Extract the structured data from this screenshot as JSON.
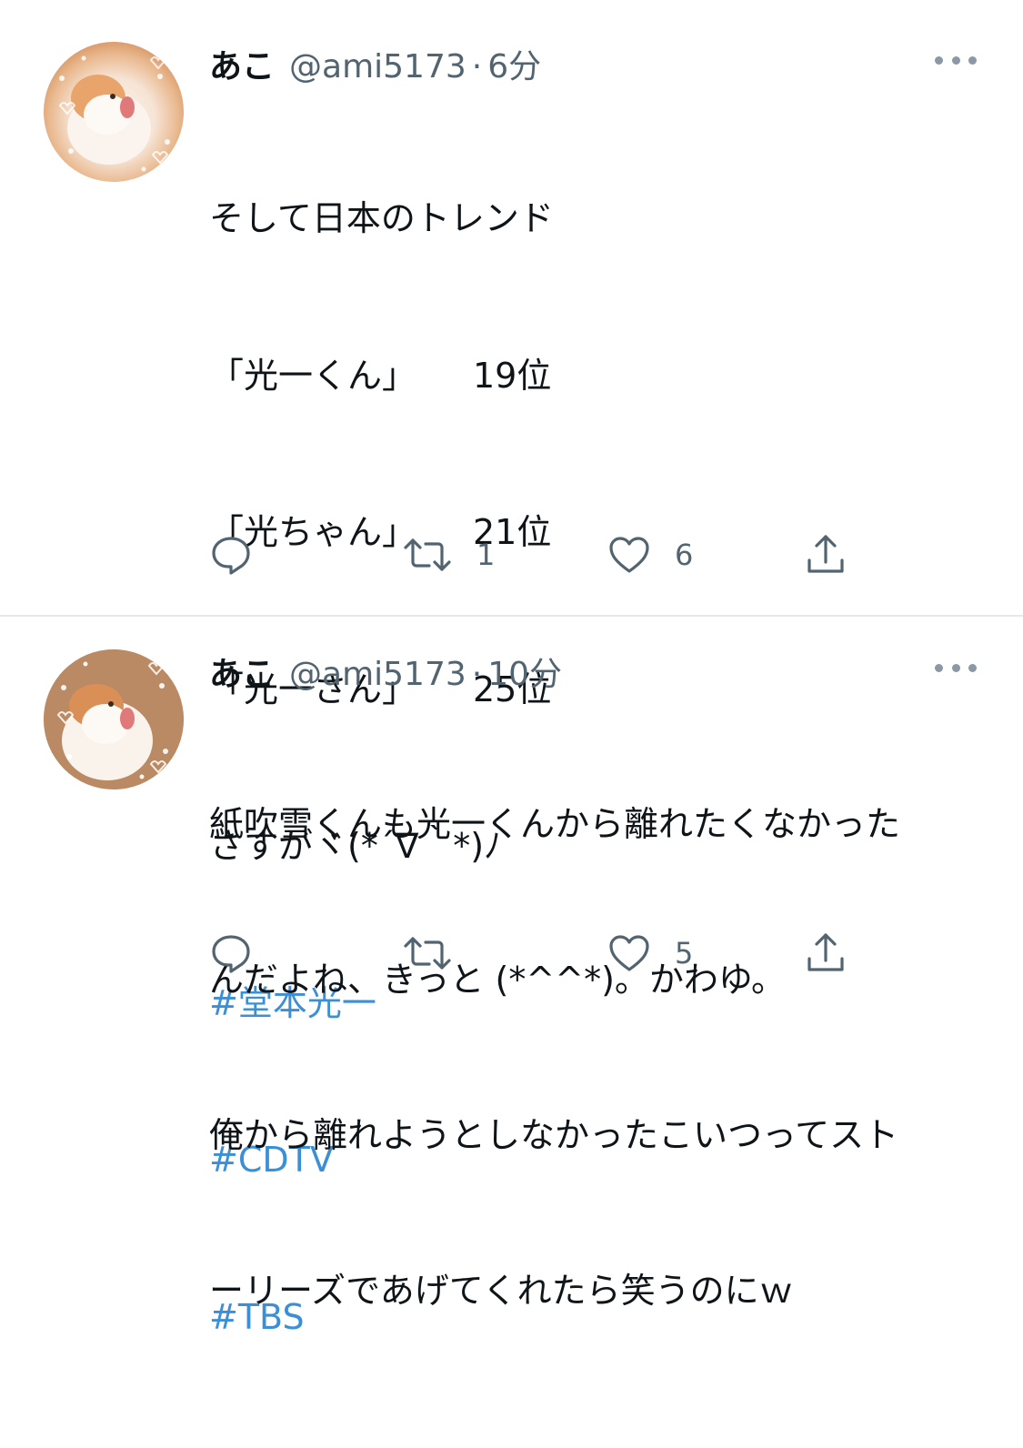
{
  "tweets": [
    {
      "name": "あこ",
      "handle": "@ami5173",
      "separator": "·",
      "time": "6分",
      "lines": [
        "そして日本のトレンド",
        {
          "label": "「光一くん」",
          "rank": "19位"
        },
        {
          "label": "「光ちゃん」",
          "rank": "21位"
        },
        {
          "label": "「光一さん」",
          "rank": "25位"
        },
        "さすがヾ(*´∇｀*)ﾉ"
      ],
      "hashtags": [
        "#堂本光一",
        "#CDTV",
        "#TBS"
      ],
      "retweet_count": "1",
      "like_count": "6",
      "icons": [
        "reply-icon",
        "retweet-icon",
        "like-icon",
        "share-icon",
        "more-icon"
      ]
    },
    {
      "name": "あこ",
      "handle": "@ami5173",
      "separator": "·",
      "time": "10分",
      "lines": [
        "紙吹雪くんも光一くんから離れたくなかった",
        "んだよね、きっと (*^^*)。かわゆ。",
        "俺から離れようとしなかったこいつってスト",
        "ーリーズであげてくれたら笑うのにｗ"
      ],
      "retweet_count": "",
      "like_count": "5",
      "icons": [
        "reply-icon",
        "retweet-icon",
        "like-icon",
        "share-icon",
        "more-icon"
      ]
    }
  ],
  "colors": {
    "text": "#0f1419",
    "secondary": "#536471",
    "hashtag": "#3b8fd6",
    "divider": "#e6e8eb"
  }
}
